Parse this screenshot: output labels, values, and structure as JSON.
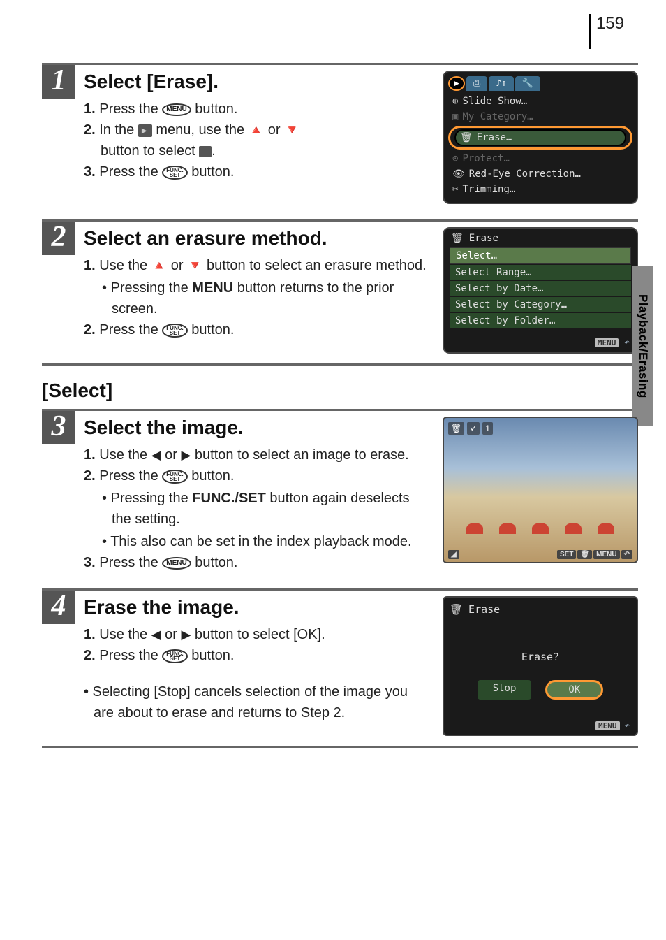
{
  "page_number": "159",
  "side_tab": "Playback/Erasing",
  "step1": {
    "number": "1",
    "title": "Select [Erase].",
    "line1_prefix": "1.",
    "line1_a": " Press the ",
    "line1_btn": "MENU",
    "line1_b": " button.",
    "line2_prefix": "2.",
    "line2_a": " In the ",
    "line2_b": " menu, use the ",
    "line2_c": " or ",
    "line2_d": " button to select ",
    "line2_e": ".",
    "line3_prefix": "3.",
    "line3_a": " Press the ",
    "line3_btn_top": "FUNC.",
    "line3_btn_bot": "SET",
    "line3_b": " button.",
    "screen": {
      "tab_print": "⎙",
      "tab_sound": "♪↑",
      "tab_tools": "🔧",
      "item1": "Slide Show…",
      "item2": "My Category…",
      "item3_icon": "🗑",
      "item3": "Erase…",
      "item4": "Protect…",
      "item5_icon": "👁",
      "item5": "Red-Eye Correction…",
      "item6_icon": "✂",
      "item6": "Trimming…"
    }
  },
  "step2": {
    "number": "2",
    "title": "Select an erasure method.",
    "line1_prefix": "1.",
    "line1_a": " Use the ",
    "line1_b": " or ",
    "line1_c": " button to select an erasure method.",
    "bullet1": "• Pressing the ",
    "bullet1_menu": "MENU",
    "bullet1_b": " button returns to the prior screen.",
    "line2_prefix": "2.",
    "line2_a": " Press the ",
    "line2_btn_top": "FUNC.",
    "line2_btn_bot": "SET",
    "line2_b": " button.",
    "screen": {
      "header_icon": "🗑",
      "header": "Erase",
      "opt1": "Select…",
      "opt2": "Select Range…",
      "opt3": "Select by Date…",
      "opt4": "Select by Category…",
      "opt5": "Select by Folder…",
      "footer": "MENU",
      "footer_icon": "↶"
    }
  },
  "select_section": "[Select]",
  "step3": {
    "number": "3",
    "title": "Select the image.",
    "line1_prefix": "1.",
    "line1_a": " Use the ",
    "line1_b": " or ",
    "line1_c": " button to select an image to erase.",
    "line2_prefix": "2.",
    "line2_a": " Press the ",
    "line2_btn_top": "FUNC.",
    "line2_btn_bot": "SET",
    "line2_b": " button.",
    "bullet1": "• Pressing the ",
    "bullet1_b": "FUNC./SET",
    "bullet1_c": " button again deselects the setting.",
    "bullet2": "• This also can be set in the index playback mode.",
    "line3_prefix": "3.",
    "line3_a": " Press the ",
    "line3_btn": "MENU",
    "line3_b": " button.",
    "screen": {
      "top_icon1": "🗑",
      "top_icon2": "✓",
      "top_count": "1",
      "bl_icon": "◢",
      "br_set": "SET",
      "br_trash": "🗑",
      "br_menu": "MENU",
      "br_back": "↶"
    }
  },
  "step4": {
    "number": "4",
    "title": "Erase the image.",
    "line1_prefix": "1.",
    "line1_a": " Use the ",
    "line1_b": " or ",
    "line1_c": " button to select [OK].",
    "line2_prefix": "2.",
    "line2_a": " Press the ",
    "line2_btn_top": "FUNC.",
    "line2_btn_bot": "SET",
    "line2_b": " button.",
    "bullet1": "• Selecting [Stop] cancels selection of the image you are about to erase and returns to Step 2.",
    "screen": {
      "header_icon": "🗑",
      "header": "Erase",
      "prompt": "Erase?",
      "btn_stop": "Stop",
      "btn_ok": "OK",
      "footer": "MENU",
      "footer_icon": "↶"
    }
  }
}
